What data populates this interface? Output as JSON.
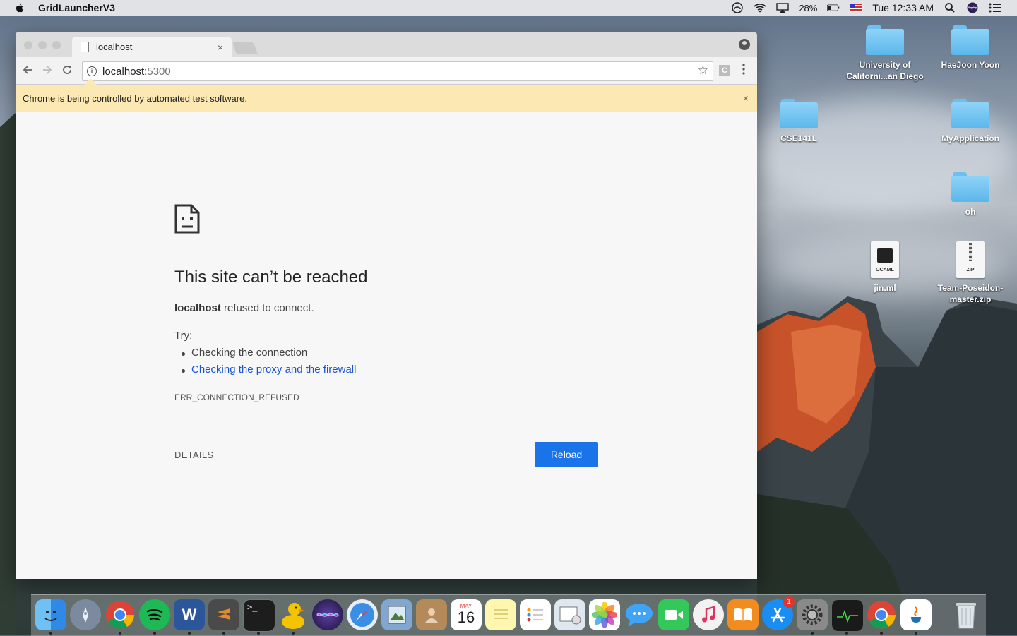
{
  "menubar": {
    "app_name": "GridLauncherV3",
    "battery": "28%",
    "clock": "Tue 12:33 AM",
    "icons": [
      "creative-cloud-icon",
      "wifi-icon",
      "airplay-icon",
      "battery-icon",
      "flag-us-icon",
      "spotlight-search-icon",
      "siri-icon",
      "notification-center-icon"
    ]
  },
  "desktop": {
    "items": [
      {
        "label": "University of Californi...an Diego",
        "type": "folder"
      },
      {
        "label": "HaeJoon Yoon",
        "type": "folder"
      },
      {
        "label": "CSE141L",
        "type": "folder"
      },
      {
        "label": "MyApplication",
        "type": "folder"
      },
      {
        "label": "oh",
        "type": "folder"
      },
      {
        "label": "jin.ml",
        "type": "file",
        "badge": "OCAML"
      },
      {
        "label": "Team-Poseidon-master.zip",
        "type": "file",
        "badge": "ZIP"
      }
    ]
  },
  "browser": {
    "tab_title": "localhost",
    "address_host": "localhost",
    "address_port": ":5300",
    "ext_label": "C",
    "infobar_message": "Chrome is being controlled by automated test software.",
    "close_glyph": "×"
  },
  "error_page": {
    "title": "This site can’t be reached",
    "desc_host": "localhost",
    "desc_rest": " refused to connect.",
    "try_label": "Try:",
    "suggestions": [
      "Checking the connection",
      "Checking the proxy and the firewall"
    ],
    "error_code": "ERR_CONNECTION_REFUSED",
    "details_label": "DETAILS",
    "reload_label": "Reload"
  },
  "dock": {
    "calendar_month": "MAY",
    "calendar_day": "16",
    "app_store_badge": "1",
    "apps": [
      "finder",
      "launchpad",
      "chrome",
      "spotify",
      "word",
      "sublime-text",
      "terminal",
      "cyberduck",
      "siri",
      "safari",
      "preview",
      "contacts",
      "calendar",
      "notes",
      "reminders",
      "photo-booth",
      "photos",
      "messages",
      "facetime",
      "itunes",
      "ibooks",
      "app-store",
      "system-preferences",
      "activity-monitor",
      "chrome",
      "java",
      "trash"
    ],
    "colors": {
      "finder": "#2e8ae6",
      "launchpad": "#7c8aa0",
      "chrome": "#ffffff",
      "spotify": "#1db954",
      "word": "#2b579a",
      "sublime": "#e38b2c",
      "terminal": "#1d1d1d",
      "cyberduck": "#f5c400",
      "siri": "#3a2f6b",
      "safari": "#3a8ee6",
      "preview": "#7fa7cf",
      "contacts": "#b58a5a",
      "calendar": "#ffffff",
      "notes": "#fff7b0",
      "reminders": "#ffffff",
      "photobooth": "#dfe7ef",
      "photos": "#ffffff",
      "messages": "#3fa4f5",
      "facetime": "#34c759",
      "itunes": "#f2f2f2",
      "ibooks": "#f28c1e",
      "appstore": "#1a8df2",
      "sysprefs": "#8a8a8a",
      "activity": "#1a1a1a",
      "java": "#ffffff",
      "trash": "#d7dde3"
    }
  }
}
